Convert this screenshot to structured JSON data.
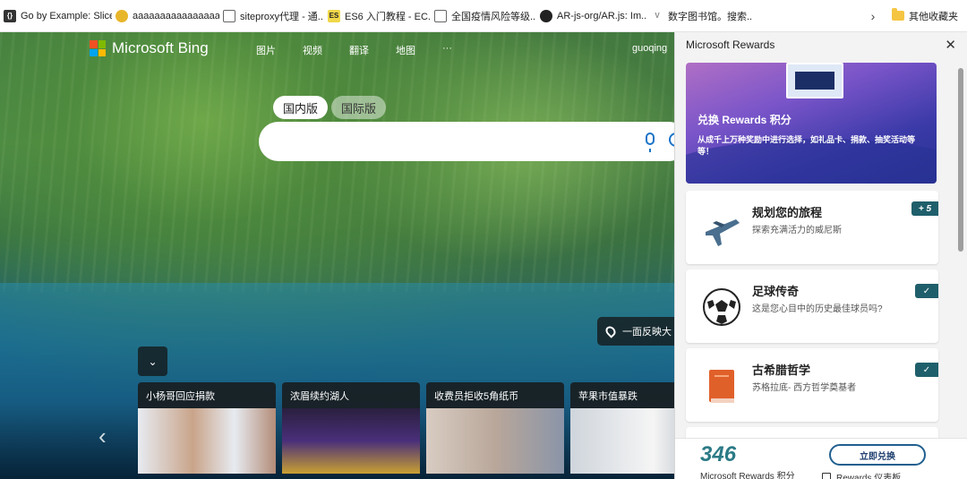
{
  "bookmarks": [
    {
      "label": "Go by Example: Slices",
      "icon": "code-icon",
      "color": "#333333"
    },
    {
      "label": "aaaaaaaaaaaaaaaaaa...",
      "icon": "app-icon",
      "color": "#e8b62b"
    },
    {
      "label": "siteproxy代理 - 通...",
      "icon": "page-icon",
      "color": "#666666"
    },
    {
      "label": "ES6 入门教程 - EC...",
      "icon": "es-icon",
      "color": "#f0d74a"
    },
    {
      "label": "全国疫情风险等级...",
      "icon": "page-icon",
      "color": "#666666"
    },
    {
      "label": "AR-js-org/AR.js: Im...",
      "icon": "github-icon",
      "color": "#222222"
    },
    {
      "label": "数字图书馆。搜索...",
      "icon": "v-icon",
      "color": "#888888"
    }
  ],
  "bookmarks_more": "其他收藏夹",
  "bing": {
    "logo_text": "Microsoft Bing",
    "nav": [
      "图片",
      "视频",
      "翻译",
      "地图",
      "···"
    ],
    "user": "guoqing",
    "tabs": {
      "domestic": "国内版",
      "international": "国际版"
    },
    "search_placeholder": "",
    "location_text": "一面反映大",
    "news": [
      {
        "title": "小杨哥回应捐款",
        "image_colors": [
          "#e7ebf1",
          "#c9a48a"
        ]
      },
      {
        "title": "浓眉续约湖人",
        "image_colors": [
          "#4a2f7a",
          "#c9a032"
        ]
      },
      {
        "title": "收费员拒收5角纸币",
        "image_colors": [
          "#d8ccc2",
          "#8a95a8"
        ]
      },
      {
        "title": "苹果市值暴跌",
        "image_colors": [
          "#cfd5dc",
          "#f5f5f5"
        ]
      }
    ]
  },
  "rewards": {
    "title": "Microsoft Rewards",
    "promo_title": "兑换 Rewards 积分",
    "promo_text": "从成千上万种奖励中进行选择，如礼品卡、捐款、抽奖活动等等！",
    "tasks": [
      {
        "title": "规划您的旅程",
        "subtitle": "探索充满活力的威尼斯",
        "badge": "+ 5",
        "icon": "airplane-icon"
      },
      {
        "title": "足球传奇",
        "subtitle": "这是您心目中的历史最佳球员吗?",
        "badge": "✓",
        "icon": "soccer-ball-icon"
      },
      {
        "title": "古希腊哲学",
        "subtitle": "苏格拉底- 西方哲学奠基者",
        "badge": "✓",
        "icon": "book-icon"
      }
    ],
    "points": "346",
    "points_label": "Microsoft Rewards 积分",
    "redeem_label": "立即兑换",
    "dashboard_label": "Rewards 仪表板"
  }
}
